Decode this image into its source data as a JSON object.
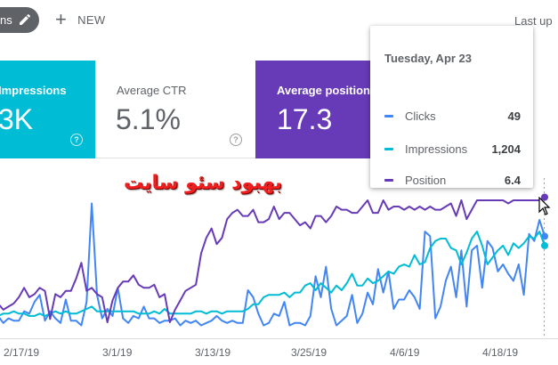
{
  "toolbar": {
    "chip_label": "ns",
    "new_label": "NEW",
    "last_updated_label": "Last up"
  },
  "metrics": {
    "impressions": {
      "label": "Impressions",
      "value": "3K"
    },
    "ctr": {
      "label": "Average CTR",
      "value": "5.1%"
    },
    "position": {
      "label": "Average position",
      "value": "17.3"
    }
  },
  "overlay_text": "بهبود سئو سایت",
  "tooltip": {
    "date": "Tuesday, Apr 23",
    "rows": [
      {
        "name": "Clicks",
        "value": "49",
        "color": "#4285f4"
      },
      {
        "name": "Impressions",
        "value": "1,204",
        "color": "#00bcd4"
      },
      {
        "name": "Position",
        "value": "6.4",
        "color": "#673ab7"
      }
    ]
  },
  "colors": {
    "clicks": "#4285f4",
    "impressions": "#00bcd4",
    "position": "#673ab7"
  },
  "chart_data": {
    "type": "line",
    "x_ticks": [
      "2/17/19",
      "3/1/19",
      "3/13/19",
      "3/25/19",
      "4/6/19",
      "4/18/19"
    ],
    "series": [
      {
        "name": "Clicks",
        "color": "#4285f4",
        "values": [
          6,
          8,
          5,
          7,
          6,
          6,
          10,
          9,
          14,
          17,
          6,
          10,
          7,
          5,
          15,
          6,
          6,
          4,
          14,
          56,
          17,
          7,
          11,
          8,
          20,
          7,
          5,
          8,
          7,
          12,
          7,
          7,
          5,
          6,
          6,
          7,
          4,
          6,
          5,
          6,
          4,
          5,
          6,
          8,
          6,
          5,
          6,
          5,
          5,
          19,
          16,
          9,
          4,
          5,
          9,
          8,
          14,
          4,
          5,
          5,
          4,
          8,
          25,
          16,
          29,
          11,
          4,
          6,
          8,
          17,
          5,
          9,
          18,
          13,
          28,
          18,
          27,
          11,
          15,
          15,
          19,
          16,
          11,
          44,
          42,
          7,
          12,
          23,
          29,
          16,
          36,
          12,
          36,
          38,
          20,
          40,
          37,
          27,
          30,
          26,
          23,
          30,
          17,
          43,
          40,
          49,
          42
        ]
      },
      {
        "name": "Impressions",
        "color": "#00bcd4",
        "values": [
          9,
          8,
          9,
          9,
          10,
          9,
          9,
          8,
          8,
          9,
          8,
          9,
          10,
          9,
          10,
          9,
          9,
          10,
          11,
          12,
          10,
          10,
          10,
          10,
          10,
          10,
          10,
          10,
          9,
          9,
          9,
          10,
          9,
          11,
          9,
          9,
          9,
          9,
          9,
          10,
          10,
          9,
          10,
          10,
          9,
          10,
          10,
          10,
          10,
          11,
          13,
          13,
          16,
          17,
          17,
          17,
          18,
          16,
          18,
          18,
          21,
          22,
          19,
          22,
          20,
          18,
          21,
          19,
          22,
          26,
          21,
          21,
          24,
          22,
          23,
          25,
          27,
          26,
          29,
          30,
          29,
          34,
          30,
          31,
          37,
          40,
          41,
          41,
          37,
          36,
          30,
          35,
          41,
          44,
          38,
          30,
          33,
          36,
          38,
          34,
          39,
          37,
          39,
          42,
          41,
          44,
          38
        ]
      },
      {
        "name": "Position",
        "color": "#673ab7",
        "values": [
          37,
          35,
          37,
          36,
          35,
          33,
          30,
          33,
          32,
          30,
          31,
          40,
          32,
          33,
          31,
          31,
          27,
          22,
          31,
          30,
          32,
          33,
          41,
          34,
          30,
          28,
          28,
          26,
          29,
          30,
          30,
          29,
          33,
          32,
          41,
          37,
          34,
          31,
          30,
          29,
          19,
          14,
          11,
          16,
          14,
          8,
          6,
          5,
          7,
          7,
          5,
          9,
          9,
          8,
          4,
          8,
          6,
          6,
          8,
          10,
          9,
          11,
          7,
          7,
          9,
          7,
          4,
          5,
          5,
          6,
          6,
          4,
          2,
          6,
          6,
          2,
          5,
          4,
          4,
          5,
          4,
          5,
          4,
          5,
          4,
          5,
          5,
          4,
          3,
          7,
          2,
          8,
          5,
          2,
          2,
          2,
          2,
          2,
          2,
          3,
          2,
          2,
          2,
          2,
          2,
          2,
          1
        ]
      }
    ]
  }
}
